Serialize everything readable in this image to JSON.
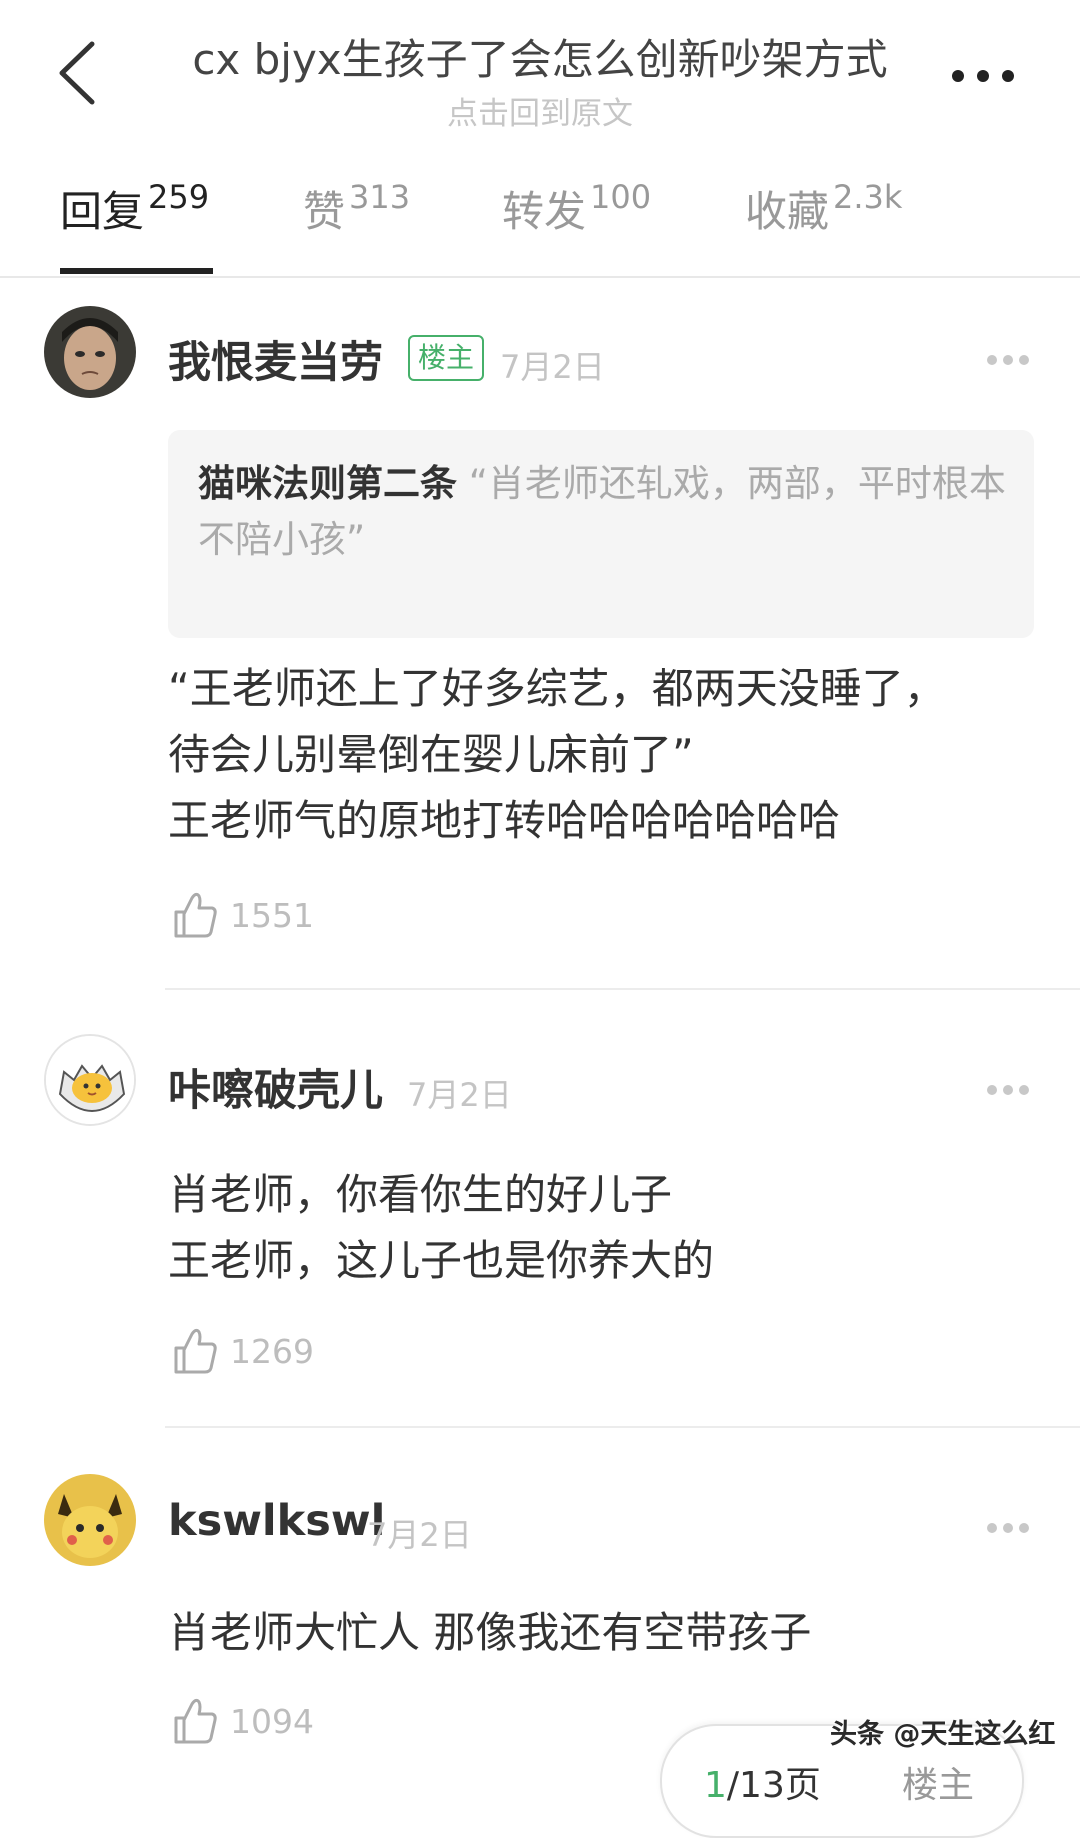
{
  "header": {
    "title": "cx bjyx生孩子了会怎么创新吵架方式",
    "subtitle": "点击回到原文"
  },
  "tabs": [
    {
      "label": "回复",
      "count": "259",
      "active": true
    },
    {
      "label": "赞",
      "count": "313",
      "active": false
    },
    {
      "label": "转发",
      "count": "100",
      "active": false
    },
    {
      "label": "收藏",
      "count": "2.3k",
      "active": false
    }
  ],
  "comments": [
    {
      "username": "我恨麦当劳",
      "badge": "楼主",
      "date": "7月2日",
      "quote": {
        "author": "猫咪法则第二条",
        "text": "“肖老师还轧戏，两部，平时根本不陪小孩”"
      },
      "lines": [
        "“王老师还上了好多综艺，都两天没睡了，",
        "待会儿别晕倒在婴儿床前了”",
        "王老师气的原地打转哈哈哈哈哈哈哈"
      ],
      "likes": "1551"
    },
    {
      "username": "咔嚓破壳儿",
      "date": "7月2日",
      "lines": [
        "肖老师，你看你生的好儿子",
        "王老师，这儿子也是你养大的"
      ],
      "likes": "1269"
    },
    {
      "username": "kswlkswl",
      "date": "7月2日",
      "lines": [
        "肖老师大忙人 那像我还有空带孩子"
      ],
      "likes": "1094"
    }
  ],
  "pager": {
    "current": "1",
    "total_label": "/13页",
    "host_label": "楼主"
  },
  "watermark": "头条 @天生这么红",
  "colors": {
    "accent_green": "#46b06a",
    "text_primary": "#333333",
    "text_muted": "#c4c4c4",
    "quote_bg": "#f5f5f5"
  },
  "icons": [
    "back-arrow-icon",
    "more-dots-icon",
    "thumbs-up-icon"
  ]
}
